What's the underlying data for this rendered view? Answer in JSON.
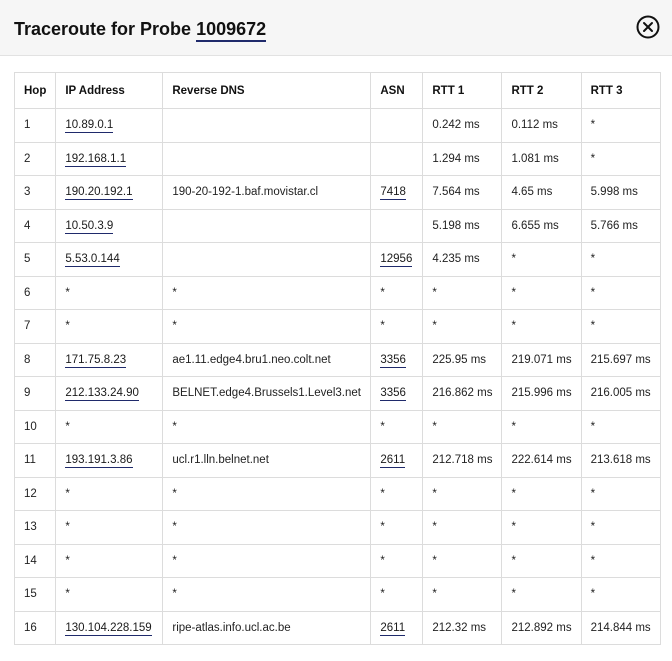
{
  "header": {
    "title_prefix": "Traceroute for Probe ",
    "probe_id": "1009672",
    "close_icon": "close-circle-x"
  },
  "table": {
    "columns": [
      "Hop",
      "IP Address",
      "Reverse DNS",
      "ASN",
      "RTT 1",
      "RTT 2",
      "RTT 3"
    ],
    "rows": [
      {
        "hop": "1",
        "ip": "10.89.0.1",
        "dns": "",
        "asn": "",
        "rtt1": "0.242 ms",
        "rtt2": "0.112 ms",
        "rtt3": "*"
      },
      {
        "hop": "2",
        "ip": "192.168.1.1",
        "dns": "",
        "asn": "",
        "rtt1": "1.294 ms",
        "rtt2": "1.081 ms",
        "rtt3": "*"
      },
      {
        "hop": "3",
        "ip": "190.20.192.1",
        "dns": "190-20-192-1.baf.movistar.cl",
        "asn": "7418",
        "rtt1": "7.564 ms",
        "rtt2": "4.65 ms",
        "rtt3": "5.998 ms"
      },
      {
        "hop": "4",
        "ip": "10.50.3.9",
        "dns": "",
        "asn": "",
        "rtt1": "5.198 ms",
        "rtt2": "6.655 ms",
        "rtt3": "5.766 ms"
      },
      {
        "hop": "5",
        "ip": "5.53.0.144",
        "dns": "",
        "asn": "12956",
        "rtt1": "4.235 ms",
        "rtt2": "*",
        "rtt3": "*"
      },
      {
        "hop": "6",
        "ip": "*",
        "dns": "*",
        "asn": "*",
        "rtt1": "*",
        "rtt2": "*",
        "rtt3": "*"
      },
      {
        "hop": "7",
        "ip": "*",
        "dns": "*",
        "asn": "*",
        "rtt1": "*",
        "rtt2": "*",
        "rtt3": "*"
      },
      {
        "hop": "8",
        "ip": "171.75.8.23",
        "dns": "ae1.11.edge4.bru1.neo.colt.net",
        "asn": "3356",
        "rtt1": "225.95 ms",
        "rtt2": "219.071 ms",
        "rtt3": "215.697 ms"
      },
      {
        "hop": "9",
        "ip": "212.133.24.90",
        "dns": "BELNET.edge4.Brussels1.Level3.net",
        "asn": "3356",
        "rtt1": "216.862 ms",
        "rtt2": "215.996 ms",
        "rtt3": "216.005 ms"
      },
      {
        "hop": "10",
        "ip": "*",
        "dns": "*",
        "asn": "*",
        "rtt1": "*",
        "rtt2": "*",
        "rtt3": "*"
      },
      {
        "hop": "11",
        "ip": "193.191.3.86",
        "dns": "ucl.r1.lln.belnet.net",
        "asn": "2611",
        "rtt1": "212.718 ms",
        "rtt2": "222.614 ms",
        "rtt3": "213.618 ms"
      },
      {
        "hop": "12",
        "ip": "*",
        "dns": "*",
        "asn": "*",
        "rtt1": "*",
        "rtt2": "*",
        "rtt3": "*"
      },
      {
        "hop": "13",
        "ip": "*",
        "dns": "*",
        "asn": "*",
        "rtt1": "*",
        "rtt2": "*",
        "rtt3": "*"
      },
      {
        "hop": "14",
        "ip": "*",
        "dns": "*",
        "asn": "*",
        "rtt1": "*",
        "rtt2": "*",
        "rtt3": "*"
      },
      {
        "hop": "15",
        "ip": "*",
        "dns": "*",
        "asn": "*",
        "rtt1": "*",
        "rtt2": "*",
        "rtt3": "*"
      },
      {
        "hop": "16",
        "ip": "130.104.228.159",
        "dns": "ripe-atlas.info.ucl.ac.be",
        "asn": "2611",
        "rtt1": "212.32 ms",
        "rtt2": "212.892 ms",
        "rtt3": "214.844 ms"
      }
    ]
  },
  "colors": {
    "link_underline": "#1f2a6b",
    "header_bg": "#f6f6f6",
    "border": "#dcdcdc"
  }
}
